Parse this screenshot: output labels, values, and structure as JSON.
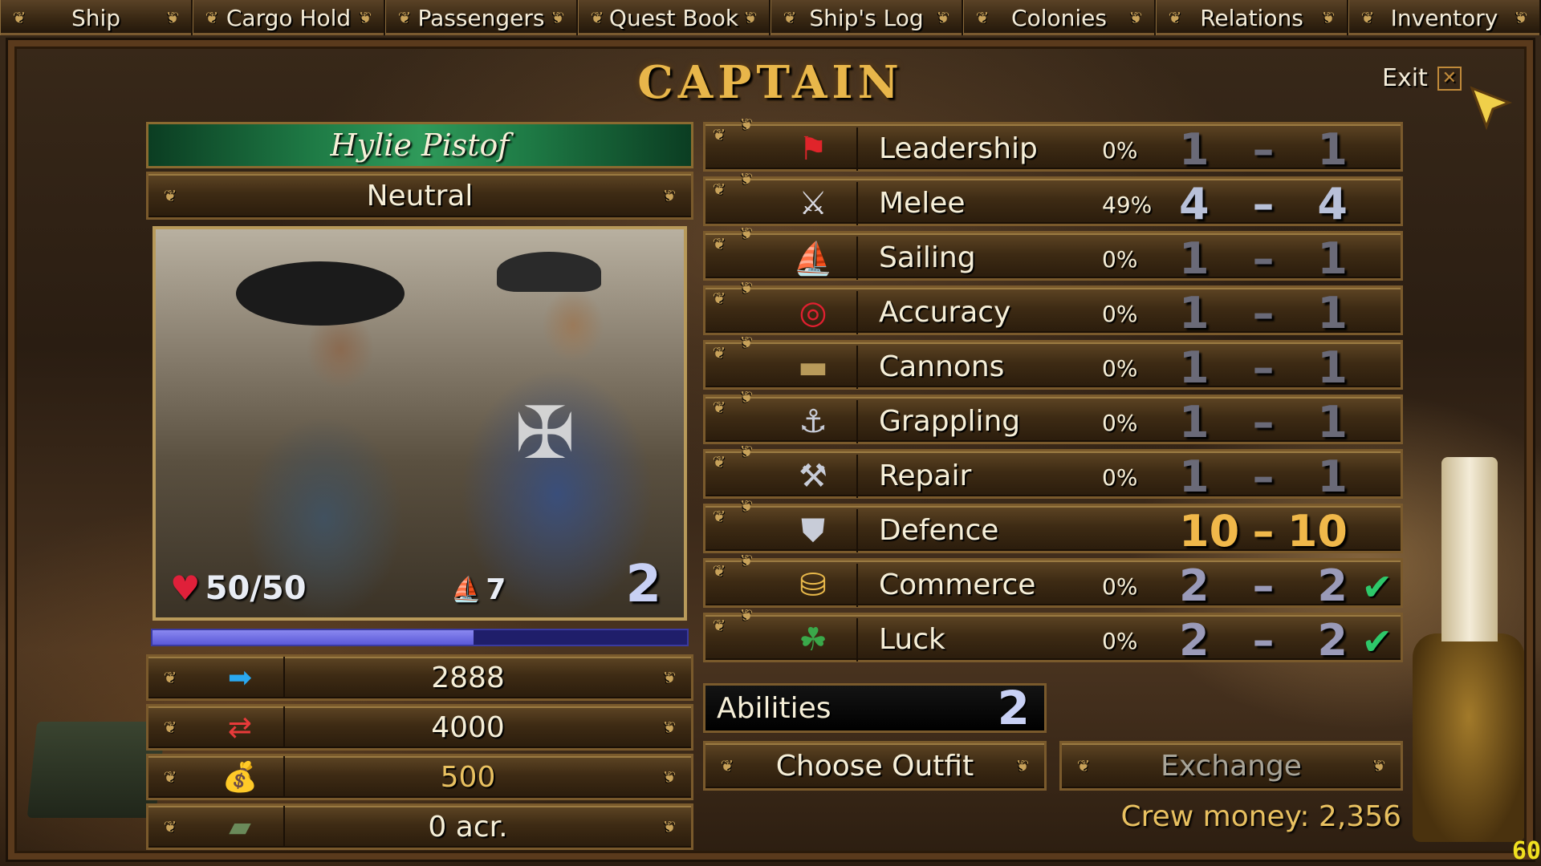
{
  "nav": {
    "tabs": [
      "Ship",
      "Cargo Hold",
      "Passengers",
      "Quest Book",
      "Ship's Log",
      "Colonies",
      "Relations",
      "Inventory"
    ]
  },
  "header": {
    "title": "CAPTAIN",
    "exit_label": "Exit"
  },
  "character": {
    "name": "Hylie Pistof",
    "reputation": "Neutral",
    "hp": "50/50",
    "ships": "7",
    "level": "2",
    "xp_fraction": 0.6
  },
  "stats": [
    {
      "icon": "experience-arrow-icon",
      "value": "2888",
      "gold": false
    },
    {
      "icon": "next-level-arrow-icon",
      "value": "4000",
      "gold": false
    },
    {
      "icon": "money-bag-icon",
      "value": "500",
      "gold": true
    },
    {
      "icon": "land-icon",
      "value": "0 acr.",
      "gold": false
    }
  ],
  "skills": [
    {
      "name": "Leadership",
      "icon": "flag-icon",
      "percent": "0%",
      "min": "1",
      "max": "1",
      "style": "dim",
      "check": false
    },
    {
      "name": "Melee",
      "icon": "crossed-swords-icon",
      "percent": "49%",
      "min": "4",
      "max": "4",
      "style": "bright",
      "check": false
    },
    {
      "name": "Sailing",
      "icon": "sailing-ship-icon",
      "percent": "0%",
      "min": "1",
      "max": "1",
      "style": "dim",
      "check": false
    },
    {
      "name": "Accuracy",
      "icon": "target-icon",
      "percent": "0%",
      "min": "1",
      "max": "1",
      "style": "dim",
      "check": false
    },
    {
      "name": "Cannons",
      "icon": "cannon-icon",
      "percent": "0%",
      "min": "1",
      "max": "1",
      "style": "dim",
      "check": false
    },
    {
      "name": "Grappling",
      "icon": "grappling-hook-icon",
      "percent": "0%",
      "min": "1",
      "max": "1",
      "style": "dim",
      "check": false
    },
    {
      "name": "Repair",
      "icon": "hammer-saw-icon",
      "percent": "0%",
      "min": "1",
      "max": "1",
      "style": "dim",
      "check": false
    },
    {
      "name": "Defence",
      "icon": "shield-icon",
      "percent": "",
      "min": "10",
      "max": "10",
      "style": "gold",
      "check": false
    },
    {
      "name": "Commerce",
      "icon": "gold-coins-icon",
      "percent": "0%",
      "min": "2",
      "max": "2",
      "style": "mid",
      "check": true
    },
    {
      "name": "Luck",
      "icon": "clover-icon",
      "percent": "0%",
      "min": "2",
      "max": "2",
      "style": "mid",
      "check": true
    }
  ],
  "abilities": {
    "label": "Abilities",
    "count": "2"
  },
  "buttons": {
    "choose_outfit": "Choose Outfit",
    "exchange": "Exchange"
  },
  "crew_money": "Crew money: 2,356",
  "fps": "60",
  "colors": {
    "gold": "#e8c060",
    "green_name_bar": "#1e7a45",
    "xp_bar": "#5a58d8",
    "check": "#2ec86a"
  }
}
